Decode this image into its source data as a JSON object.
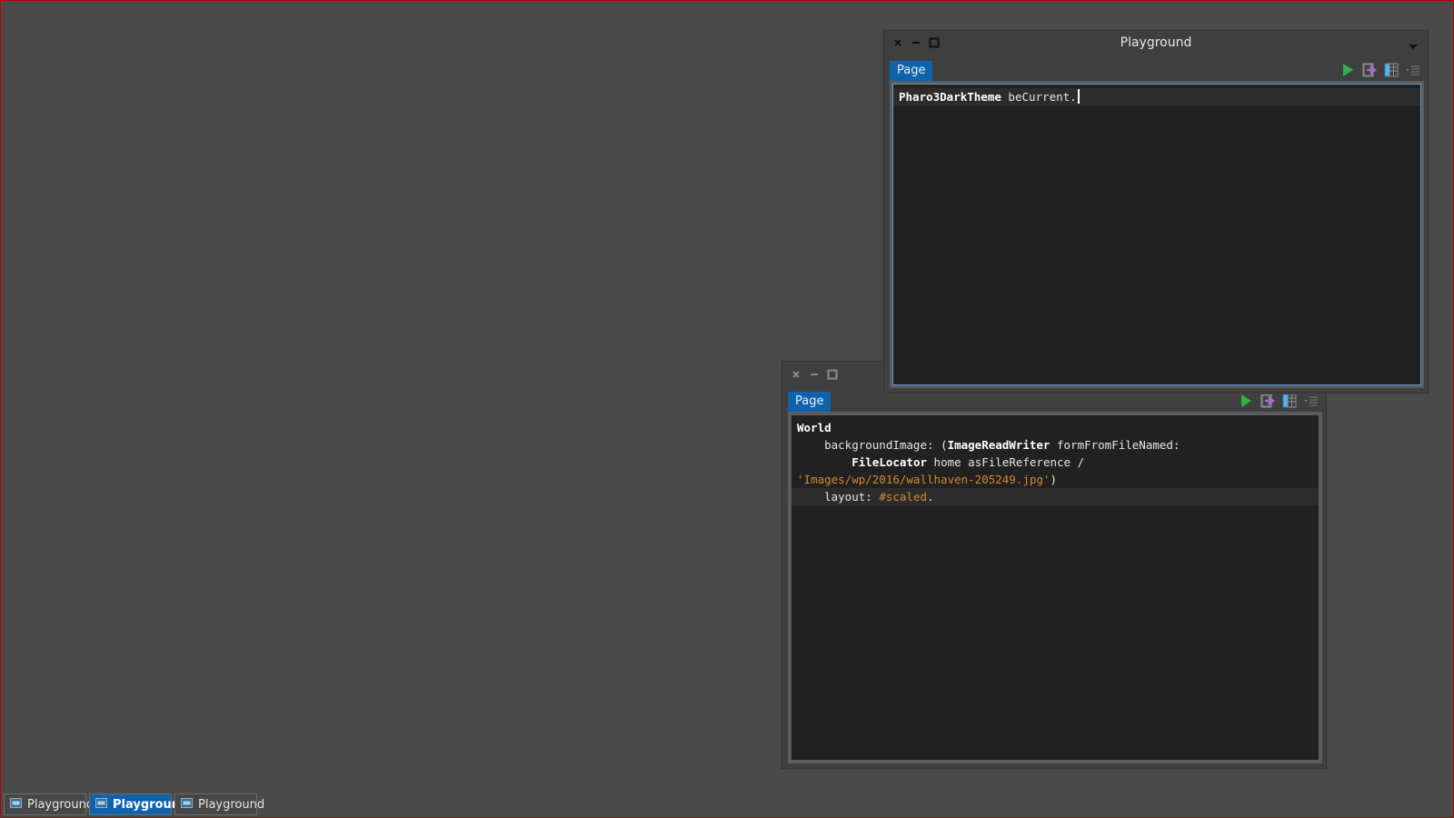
{
  "windows": [
    {
      "title": "Playground",
      "tab_label": "Page",
      "focused": true,
      "code_lines": [
        {
          "segments": [
            {
              "text": "Pharo3DarkTheme",
              "style": "kw"
            },
            {
              "text": " beCurrent.",
              "style": "plain"
            }
          ],
          "current": true,
          "caret": true
        }
      ],
      "toolbar_icons": [
        "play-icon",
        "inspect-icon",
        "bindings-icon",
        "menu-icon"
      ]
    },
    {
      "title": "",
      "tab_label": "Page",
      "focused": false,
      "code_lines": [
        {
          "segments": [
            {
              "text": "World",
              "style": "kw"
            }
          ]
        },
        {
          "segments": [
            {
              "text": "    backgroundImage: (",
              "style": "plain"
            },
            {
              "text": "ImageReadWriter",
              "style": "kw"
            },
            {
              "text": " formFromFileNamed:",
              "style": "plain"
            }
          ]
        },
        {
          "segments": [
            {
              "text": "        ",
              "style": "plain"
            },
            {
              "text": "FileLocator",
              "style": "kw"
            },
            {
              "text": " home asFileReference /",
              "style": "plain"
            }
          ]
        },
        {
          "segments": [
            {
              "text": "'Images/wp/2016/wallhaven-205249.jpg'",
              "style": "str"
            },
            {
              "text": ")",
              "style": "plain"
            }
          ]
        },
        {
          "segments": [
            {
              "text": "    layout: ",
              "style": "plain"
            },
            {
              "text": "#scaled",
              "style": "sym"
            },
            {
              "text": ".",
              "style": "plain"
            }
          ],
          "current": true
        }
      ],
      "toolbar_icons": [
        "play-icon",
        "inspect-icon",
        "bindings-icon",
        "menu-icon"
      ]
    }
  ],
  "taskbar": [
    {
      "label": "Playground",
      "active": false
    },
    {
      "label": "Playground",
      "active": true
    },
    {
      "label": "Playground",
      "active": false
    }
  ],
  "colors": {
    "desktop": "#4a4a4a",
    "accent": "#0f63ad",
    "play": "#2fb24a",
    "inspect_arrow": "#a36fc6",
    "bindings": "#5ab4f0",
    "string_literal": "#d08a2e"
  }
}
